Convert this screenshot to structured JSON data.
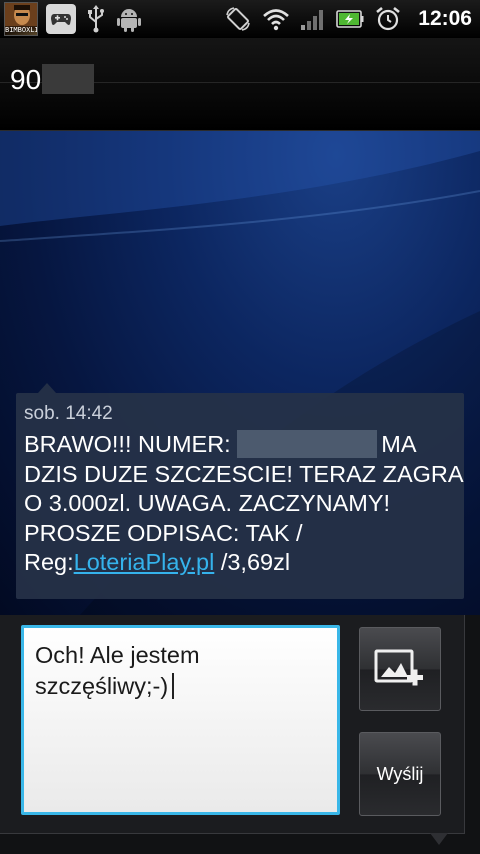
{
  "status_bar": {
    "avatar_text": "BIMBOXLIFE",
    "time": "12:06",
    "icons": [
      "avatar-icon",
      "gamepad-icon",
      "usb-icon",
      "android-debug-icon",
      "rotation-icon",
      "wifi-icon",
      "signal-icon",
      "battery-icon",
      "alarm-icon"
    ]
  },
  "header": {
    "contact_number": "90"
  },
  "message": {
    "time": "sob. 14:42",
    "line1_a": "BRAWO!!! NUMER:",
    "line1_b": "MA",
    "line2": "DZIS DUZE SZCZESCIE! TERAZ ZAGRA",
    "line3": "O 3.000zl. UWAGA. ZACZYNAMY!",
    "line4": "PROSZE ODPISAC: TAK /",
    "line5_prefix": "Reg:",
    "link": "LoteriaPlay.pl",
    "line5_suffix": " /3,69zl"
  },
  "compose": {
    "line1": "Och! Ale jestem",
    "line2": "szczęśliwy;-)",
    "send_label": "Wyślij",
    "attach_icon": "add-picture-icon"
  },
  "colors": {
    "accent": "#3ab7e8",
    "link": "#35b3ec",
    "bubble": "#263248"
  }
}
